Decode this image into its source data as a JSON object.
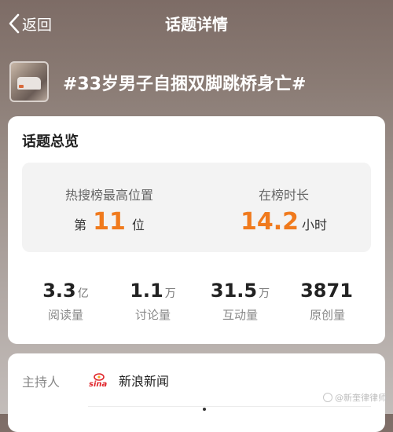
{
  "nav": {
    "back_label": "返回",
    "title": "话题详情"
  },
  "topic": {
    "title": "#33岁男子自捆双脚跳桥身亡#"
  },
  "overview": {
    "title": "话题总览",
    "rank": {
      "label": "热搜榜最高位置",
      "prefix": "第",
      "value": "11",
      "suffix": "位"
    },
    "duration": {
      "label": "在榜时长",
      "value": "14.2",
      "unit": "小时"
    },
    "stats": [
      {
        "value": "3.3",
        "unit": "亿",
        "label": "阅读量"
      },
      {
        "value": "1.1",
        "unit": "万",
        "label": "讨论量"
      },
      {
        "value": "31.5",
        "unit": "万",
        "label": "互动量"
      },
      {
        "value": "3871",
        "unit": "",
        "label": "原创量"
      }
    ]
  },
  "host": {
    "label": "主持人",
    "logo_text": "sina",
    "name": "新浪新闻"
  },
  "watermark": "@新奎律律师",
  "colors": {
    "accent": "#f07a1d"
  }
}
